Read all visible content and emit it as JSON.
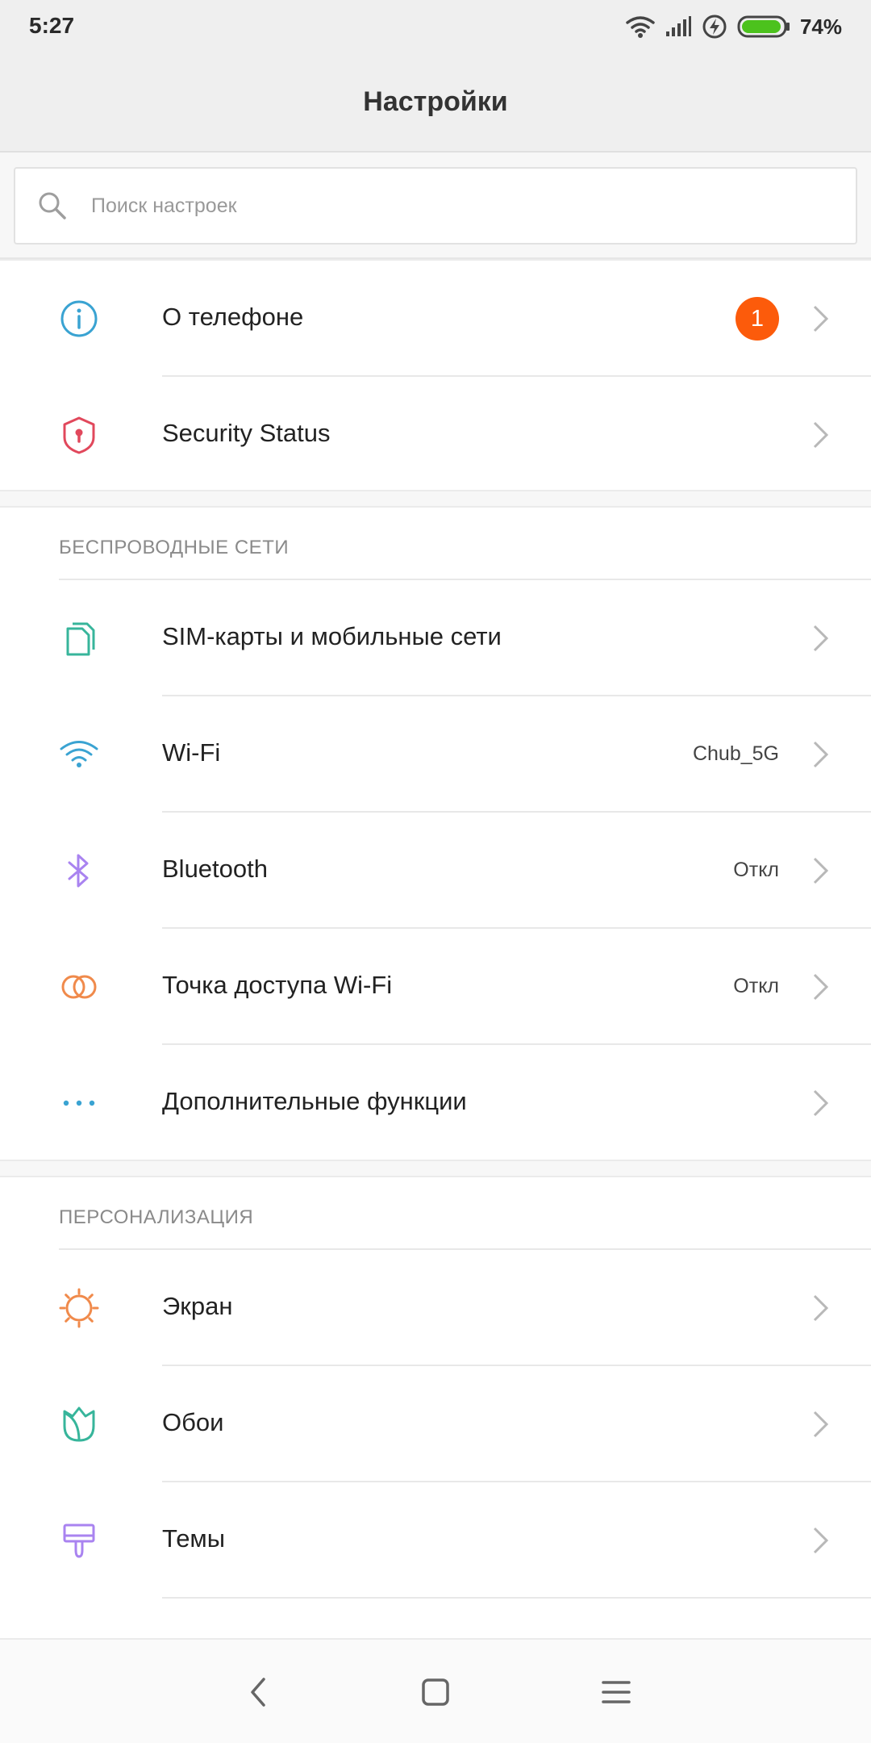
{
  "status_bar": {
    "time": "5:27",
    "battery": "74%"
  },
  "header": {
    "title": "Настройки"
  },
  "search": {
    "placeholder": "Поиск настроек"
  },
  "group1": {
    "items": [
      {
        "label": "О телефоне",
        "badge": "1",
        "icon": "info-icon"
      },
      {
        "label": "Security Status",
        "icon": "shield-icon"
      }
    ]
  },
  "wireless": {
    "header": "БЕСПРОВОДНЫЕ СЕТИ",
    "items": [
      {
        "label": "SIM-карты и мобильные сети",
        "icon": "sim-icon"
      },
      {
        "label": "Wi-Fi",
        "value": "Chub_5G",
        "icon": "wifi-icon"
      },
      {
        "label": "Bluetooth",
        "value": "Откл",
        "icon": "bluetooth-icon"
      },
      {
        "label": "Точка доступа Wi-Fi",
        "value": "Откл",
        "icon": "hotspot-icon"
      },
      {
        "label": "Дополнительные функции",
        "icon": "more-icon"
      }
    ]
  },
  "personalization": {
    "header": "ПЕРСОНАЛИЗАЦИЯ",
    "items": [
      {
        "label": "Экран",
        "icon": "display-icon"
      },
      {
        "label": "Обои",
        "icon": "wallpaper-icon"
      },
      {
        "label": "Темы",
        "icon": "themes-icon"
      }
    ]
  },
  "colors": {
    "badge": "#fc5b0b",
    "info": "#3aa3d2",
    "shield": "#e1485c",
    "sim": "#37b59b",
    "wifi": "#3aa3d2",
    "bluetooth": "#a983f0",
    "hotspot": "#f08a4b",
    "display": "#f08a4b",
    "wallpaper": "#37b59b",
    "themes": "#a983f0"
  }
}
